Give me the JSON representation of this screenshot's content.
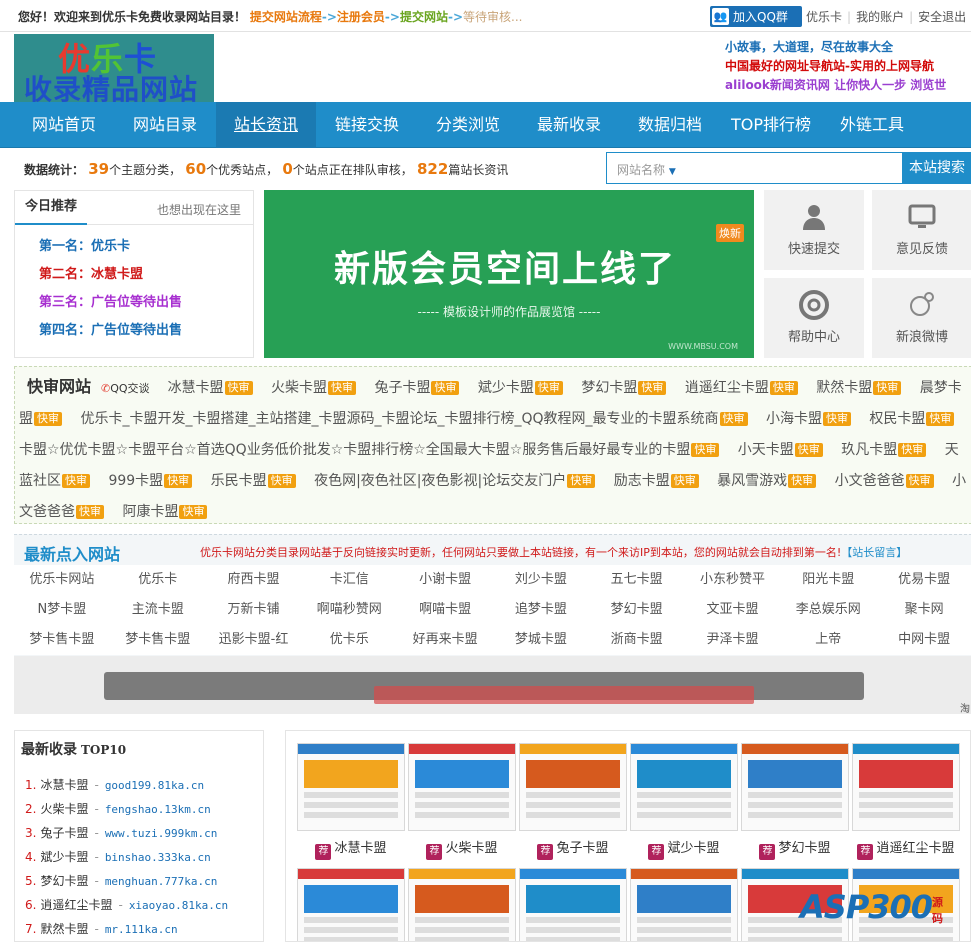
{
  "topbar": {
    "welcome": "您好！欢迎来到优乐卡免费收录网站目录！",
    "flow": [
      "提交网站流程",
      "注册会员",
      "提交网站",
      "等待审核..."
    ],
    "qq_button": "加入QQ群",
    "links": [
      "优乐卡",
      "我的账户",
      "安全退出"
    ]
  },
  "header": {
    "logo_line1": [
      "优",
      "乐",
      "卡"
    ],
    "logo_line2": "收录精品网站",
    "slogans": [
      "小故事，大道理，尽在故事大全",
      "中国最好的网址导航站-实用的上网导航",
      "alilook新闻资讯网 让你快人一步 浏览世"
    ]
  },
  "nav": [
    "网站首页",
    "网站目录",
    "站长资讯",
    "链接交换",
    "分类浏览",
    "最新收录",
    "数据归档",
    "TOP排行榜",
    "外链工具"
  ],
  "stats": {
    "label": "数据统计：",
    "categories": "39",
    "categories_t": "个主题分类，",
    "quality": "60",
    "quality_t": "个优秀站点，",
    "pending": "0",
    "pending_t": "个站点正在排队审核，",
    "news": "822",
    "news_t": "篇站长资讯"
  },
  "search": {
    "select": "网站名称",
    "button": "本站搜索"
  },
  "recommend": {
    "title": "今日推荐",
    "more": "也想出现在这里",
    "items": [
      {
        "rank": "第一名：",
        "name": "优乐卡",
        "color": "#1b6fb5"
      },
      {
        "rank": "第二名：",
        "name": "冰慧卡盟",
        "color": "#d01a1a"
      },
      {
        "rank": "第三名：",
        "name": "广告位等待出售",
        "color": "#a72fd0"
      },
      {
        "rank": "第四名：",
        "name": "广告位等待出售",
        "color": "#1b6fb5"
      }
    ]
  },
  "banner": {
    "badge": "焕新",
    "title": "新版会员空间上线了",
    "subtitle": "-----    模板设计师的作品展览馆    -----",
    "url": "WWW.MBSU.COM"
  },
  "quick": [
    "快速提交",
    "意见反馈",
    "帮助中心",
    "新浪微博"
  ],
  "kuaishen": {
    "title": "快审网站",
    "qq_label": "QQ交谈",
    "tag": "快审",
    "sites": [
      "冰慧卡盟",
      "火柴卡盟",
      "兔子卡盟",
      "斌少卡盟",
      "梦幻卡盟",
      "逍遥红尘卡盟",
      "默然卡盟",
      "晨梦卡盟",
      "优乐卡_卡盟开发_卡盟搭建_主站搭建_卡盟源码_卡盟论坛_卡盟排行榜_QQ教程网_最专业的卡盟系统商",
      "小海卡盟",
      "权民卡盟",
      "卡盟☆优优卡盟☆卡盟平台☆首选QQ业务低价批发☆卡盟排行榜☆全国最大卡盟☆服务售后最好最专业的卡盟",
      "小天卡盟",
      "玖凡卡盟",
      "天蓝社区",
      "999卡盟",
      "乐民卡盟",
      "夜色网|夜色社区|夜色影视|论坛交友门户",
      "励志卡盟",
      "暴风雪游戏",
      "小文爸爸爸",
      "小文爸爸爸",
      "阿康卡盟"
    ]
  },
  "dianru": {
    "title": "最新点入网站",
    "notice": "优乐卡网站分类目录网站基于反向链接实时更新，任何网站只要做上本站链接，有一个来访IP到本站，您的网站就会自动排到第一名!",
    "notice_link": "【站长留言】",
    "sites": [
      "优乐卡网站",
      "优乐卡",
      "府西卡盟",
      "卡汇信",
      "小谢卡盟",
      "刘少卡盟",
      "五七卡盟",
      "小东秒赞平",
      "阳光卡盟",
      "优易卡盟",
      "N梦卡盟",
      "主流卡盟",
      "万新卡铺",
      "啊喵秒赞网",
      "啊喵卡盟",
      "追梦卡盟",
      "梦幻卡盟",
      "文亚卡盟",
      "李总娱乐网",
      "聚卡网",
      "梦卡售卡盟",
      "梦卡售卡盟",
      "迅影卡盟-红",
      "优卡乐",
      "好再来卡盟",
      "梦城卡盟",
      "浙商卡盟",
      "尹泽卡盟",
      "上帝",
      "中网卡盟"
    ]
  },
  "ad": {
    "corner": "淘"
  },
  "latest": {
    "title": "最新收录",
    "top": "TOP10",
    "items": [
      {
        "no": "1.",
        "name": "冰慧卡盟",
        "domain": "good199.81ka.cn"
      },
      {
        "no": "2.",
        "name": "火柴卡盟",
        "domain": "fengshao.13km.cn"
      },
      {
        "no": "3.",
        "name": "兔子卡盟",
        "domain": "www.tuzi.999km.cn"
      },
      {
        "no": "4.",
        "name": "斌少卡盟",
        "domain": "binshao.333ka.cn"
      },
      {
        "no": "5.",
        "name": "梦幻卡盟",
        "domain": "menghuan.777ka.cn"
      },
      {
        "no": "6.",
        "name": "逍遥红尘卡盟",
        "domain": "xiaoyao.81ka.cn"
      },
      {
        "no": "7.",
        "name": "默然卡盟",
        "domain": "mr.111ka.cn"
      }
    ]
  },
  "thumbs": {
    "icon_label": "荐",
    "labels": [
      "冰慧卡盟",
      "火柴卡盟",
      "兔子卡盟",
      "斌少卡盟",
      "梦幻卡盟",
      "逍遥红尘卡盟"
    ]
  },
  "watermark": {
    "brand": "ASP300",
    "sub": "源码"
  }
}
